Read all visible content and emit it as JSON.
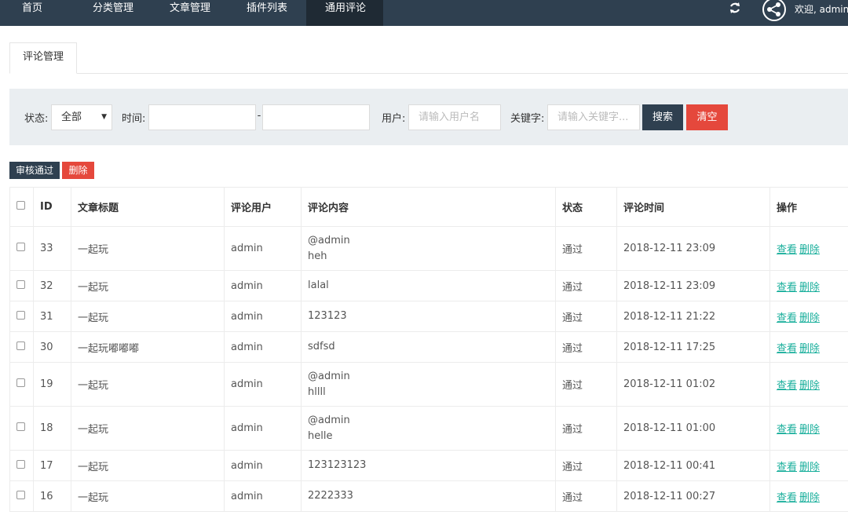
{
  "nav": {
    "items": [
      {
        "label": "首页"
      },
      {
        "label": "分类管理"
      },
      {
        "label": "文章管理"
      },
      {
        "label": "插件列表"
      },
      {
        "label": "通用评论"
      }
    ],
    "active_index": 4,
    "welcome_text": "欢迎, admin"
  },
  "tab": {
    "label": "评论管理"
  },
  "search": {
    "status_label": "状态:",
    "status_value": "全部",
    "time_label": "时间:",
    "time_separator": "-",
    "user_label": "用户:",
    "user_placeholder": "请输入用户名",
    "keyword_label": "关键字:",
    "keyword_placeholder": "请输入关键字...",
    "search_button": "搜索",
    "clear_button": "清空"
  },
  "actions": {
    "approve": "审核通过",
    "delete": "删除"
  },
  "table": {
    "headers": [
      "ID",
      "文章标题",
      "评论用户",
      "评论内容",
      "状态",
      "评论时间",
      "操作"
    ],
    "view_label": "查看",
    "delete_label": "删除",
    "rows": [
      {
        "id": "33",
        "title": "一起玩",
        "user": "admin",
        "content": [
          "@admin",
          "heh"
        ],
        "status": "通过",
        "time": "2018-12-11 23:09"
      },
      {
        "id": "32",
        "title": "一起玩",
        "user": "admin",
        "content": [
          "lalal"
        ],
        "status": "通过",
        "time": "2018-12-11 23:09"
      },
      {
        "id": "31",
        "title": "一起玩",
        "user": "admin",
        "content": [
          "123123"
        ],
        "status": "通过",
        "time": "2018-12-11 21:22"
      },
      {
        "id": "30",
        "title": "一起玩嘟嘟嘟",
        "user": "admin",
        "content": [
          "sdfsd"
        ],
        "status": "通过",
        "time": "2018-12-11 17:25"
      },
      {
        "id": "19",
        "title": "一起玩",
        "user": "admin",
        "content": [
          "@admin",
          "hllll"
        ],
        "status": "通过",
        "time": "2018-12-11 01:02"
      },
      {
        "id": "18",
        "title": "一起玩",
        "user": "admin",
        "content": [
          "@admin",
          "helle"
        ],
        "status": "通过",
        "time": "2018-12-11 01:00"
      },
      {
        "id": "17",
        "title": "一起玩",
        "user": "admin",
        "content": [
          "123123123"
        ],
        "status": "通过",
        "time": "2018-12-11 00:41"
      },
      {
        "id": "16",
        "title": "一起玩",
        "user": "admin",
        "content": [
          "2222333"
        ],
        "status": "通过",
        "time": "2018-12-11 00:27"
      }
    ]
  },
  "colors": {
    "topbar": "#2f4050",
    "active_nav": "#1f2a34",
    "danger": "#e5483c",
    "link": "#1aaf9c"
  }
}
